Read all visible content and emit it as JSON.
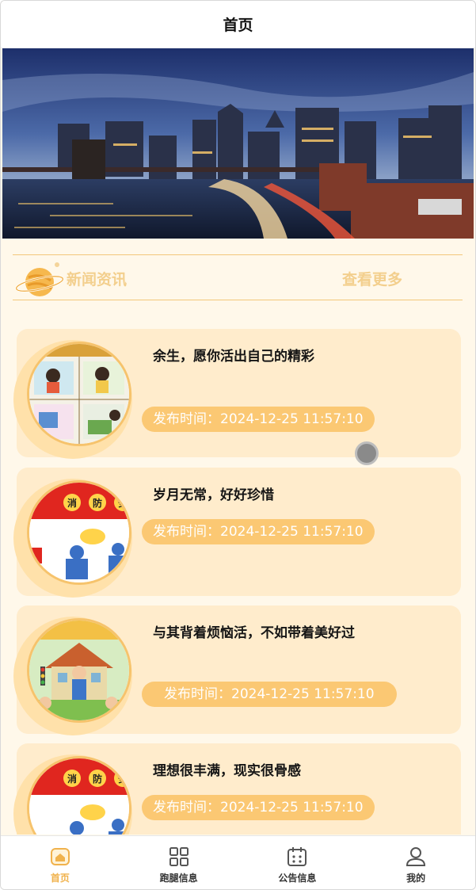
{
  "header": {
    "title": "首页"
  },
  "section": {
    "title": "新闻资讯",
    "more": "查看更多"
  },
  "news": [
    {
      "title": "余生，愿你活出自己的精彩",
      "time": "发布时间：2024-12-25 11:57:10",
      "thumb_icon": "comic-classroom-image"
    },
    {
      "title": "岁月无常，好好珍惜",
      "time": "发布时间：2024-12-25 11:57:10",
      "thumb_icon": "fire-safety-poster-image"
    },
    {
      "title": "与其背着烦恼活，不如带着美好过",
      "time": "发布时间：2024-12-25 11:57:10",
      "thumb_icon": "traffic-police-school-image"
    },
    {
      "title": "理想很丰满，现实很骨感",
      "time": "发布时间：2024-12-25 11:57:10",
      "thumb_icon": "fire-safety-poster-image"
    }
  ],
  "thumb_text": {
    "fire_chars": [
      "消",
      "防",
      "安"
    ]
  },
  "tabbar": {
    "items": [
      {
        "label": "首页",
        "icon": "home-icon",
        "active": true
      },
      {
        "label": "跑腿信息",
        "icon": "grid-icon",
        "active": false
      },
      {
        "label": "公告信息",
        "icon": "calendar-icon",
        "active": false
      },
      {
        "label": "我的",
        "icon": "user-icon",
        "active": false
      }
    ]
  },
  "colors": {
    "accent": "#f0b24c",
    "card": "#ffeccc",
    "badge": "#fbc873",
    "page_bg": "#fff8ea",
    "section_text": "#f3cf8d"
  }
}
